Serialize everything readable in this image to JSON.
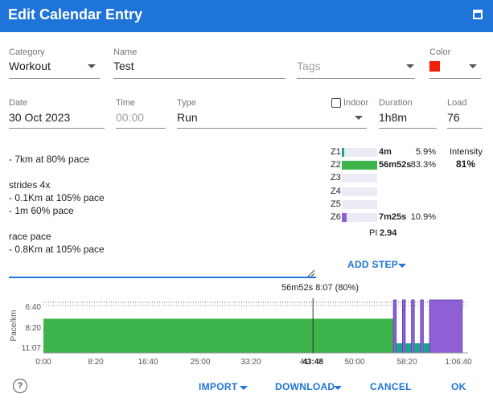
{
  "dialog": {
    "title": "Edit Calendar Entry"
  },
  "form": {
    "category": {
      "label": "Category",
      "value": "Workout"
    },
    "name": {
      "label": "Name",
      "value": "Test"
    },
    "tags": {
      "placeholder": "Tags"
    },
    "color": {
      "label": "Color",
      "value": "#f41f0a"
    },
    "date": {
      "label": "Date",
      "value": "30 Oct 2023"
    },
    "time": {
      "label": "Time",
      "placeholder": "00:00"
    },
    "type": {
      "label": "Type",
      "value": "Run"
    },
    "indoor": {
      "label": "Indoor",
      "checked": false
    },
    "duration": {
      "label": "Duration",
      "value": "1h8m"
    },
    "load": {
      "label": "Load",
      "value": "76"
    }
  },
  "notes": {
    "lines": [
      "- 7km at 80% pace",
      "",
      "strides 4x",
      "- 0.1Km at 105% pace",
      "- 1m 60% pace",
      "",
      "race pace",
      "- 0.8Km at 105% pace"
    ]
  },
  "zones": {
    "rows": [
      {
        "name": "Z1",
        "time": "4m",
        "pct": "5.9%",
        "fraction": 0.059,
        "color": "#1aa58c"
      },
      {
        "name": "Z2",
        "time": "56m52s",
        "pct": "83.3%",
        "fraction": 0.833,
        "color": "#3cb44b"
      },
      {
        "name": "Z3",
        "time": "",
        "pct": "",
        "fraction": 0,
        "color": "#ebebf5"
      },
      {
        "name": "Z4",
        "time": "",
        "pct": "",
        "fraction": 0,
        "color": "#ebebf5"
      },
      {
        "name": "Z5",
        "time": "",
        "pct": "",
        "fraction": 0,
        "color": "#ebebf5"
      },
      {
        "name": "Z6",
        "time": "7m25s",
        "pct": "10.9%",
        "fraction": 0.109,
        "color": "#8f5fd5"
      }
    ],
    "intensity_label": "Intensity",
    "intensity_value": "81%",
    "pi_label": "PI",
    "pi_value": "2.94"
  },
  "add_step": {
    "label": "ADD STEP"
  },
  "chart_readout": "56m52s 8:07 (80%)",
  "chart_data": {
    "type": "area",
    "ylabel": "Pace/km",
    "yticks": [
      "6:40",
      "8:20",
      "11:07"
    ],
    "xticks": [
      "0:00",
      "8:20",
      "16:40",
      "25:00",
      "33:20",
      "41",
      "50:00",
      "58:20",
      "1:06:40"
    ],
    "cursor_label": "43:48",
    "xlim_seconds": [
      0,
      4140
    ],
    "cursor_seconds": 2628,
    "segments": [
      {
        "start_s": 0,
        "end_s": 3412,
        "pace": "8:07",
        "zone": "Z2",
        "color": "#3cb44b"
      },
      {
        "start_s": 3412,
        "end_s": 3440,
        "pace": "6:10",
        "zone": "Z6",
        "color": "#8f5fd5"
      },
      {
        "start_s": 3440,
        "end_s": 3500,
        "pace": "10:40",
        "zone": "Z1",
        "color": "#1aa58c"
      },
      {
        "start_s": 3500,
        "end_s": 3528,
        "pace": "6:10",
        "zone": "Z6",
        "color": "#8f5fd5"
      },
      {
        "start_s": 3528,
        "end_s": 3588,
        "pace": "10:40",
        "zone": "Z1",
        "color": "#1aa58c"
      },
      {
        "start_s": 3588,
        "end_s": 3616,
        "pace": "6:10",
        "zone": "Z6",
        "color": "#8f5fd5"
      },
      {
        "start_s": 3616,
        "end_s": 3676,
        "pace": "10:40",
        "zone": "Z1",
        "color": "#1aa58c"
      },
      {
        "start_s": 3676,
        "end_s": 3704,
        "pace": "6:10",
        "zone": "Z6",
        "color": "#8f5fd5"
      },
      {
        "start_s": 3704,
        "end_s": 3764,
        "pace": "10:40",
        "zone": "Z1",
        "color": "#1aa58c"
      },
      {
        "start_s": 3764,
        "end_s": 4084,
        "pace": "6:10",
        "zone": "Z6",
        "color": "#8f5fd5"
      }
    ]
  },
  "footer": {
    "help_icon": "?",
    "import": "IMPORT",
    "download": "DOWNLOAD",
    "cancel": "CANCEL",
    "ok": "OK"
  },
  "colors": {
    "accent": "#1e74d8",
    "z2": "#3cb44b",
    "z6": "#8f5fd5",
    "z1": "#1aa58c"
  }
}
